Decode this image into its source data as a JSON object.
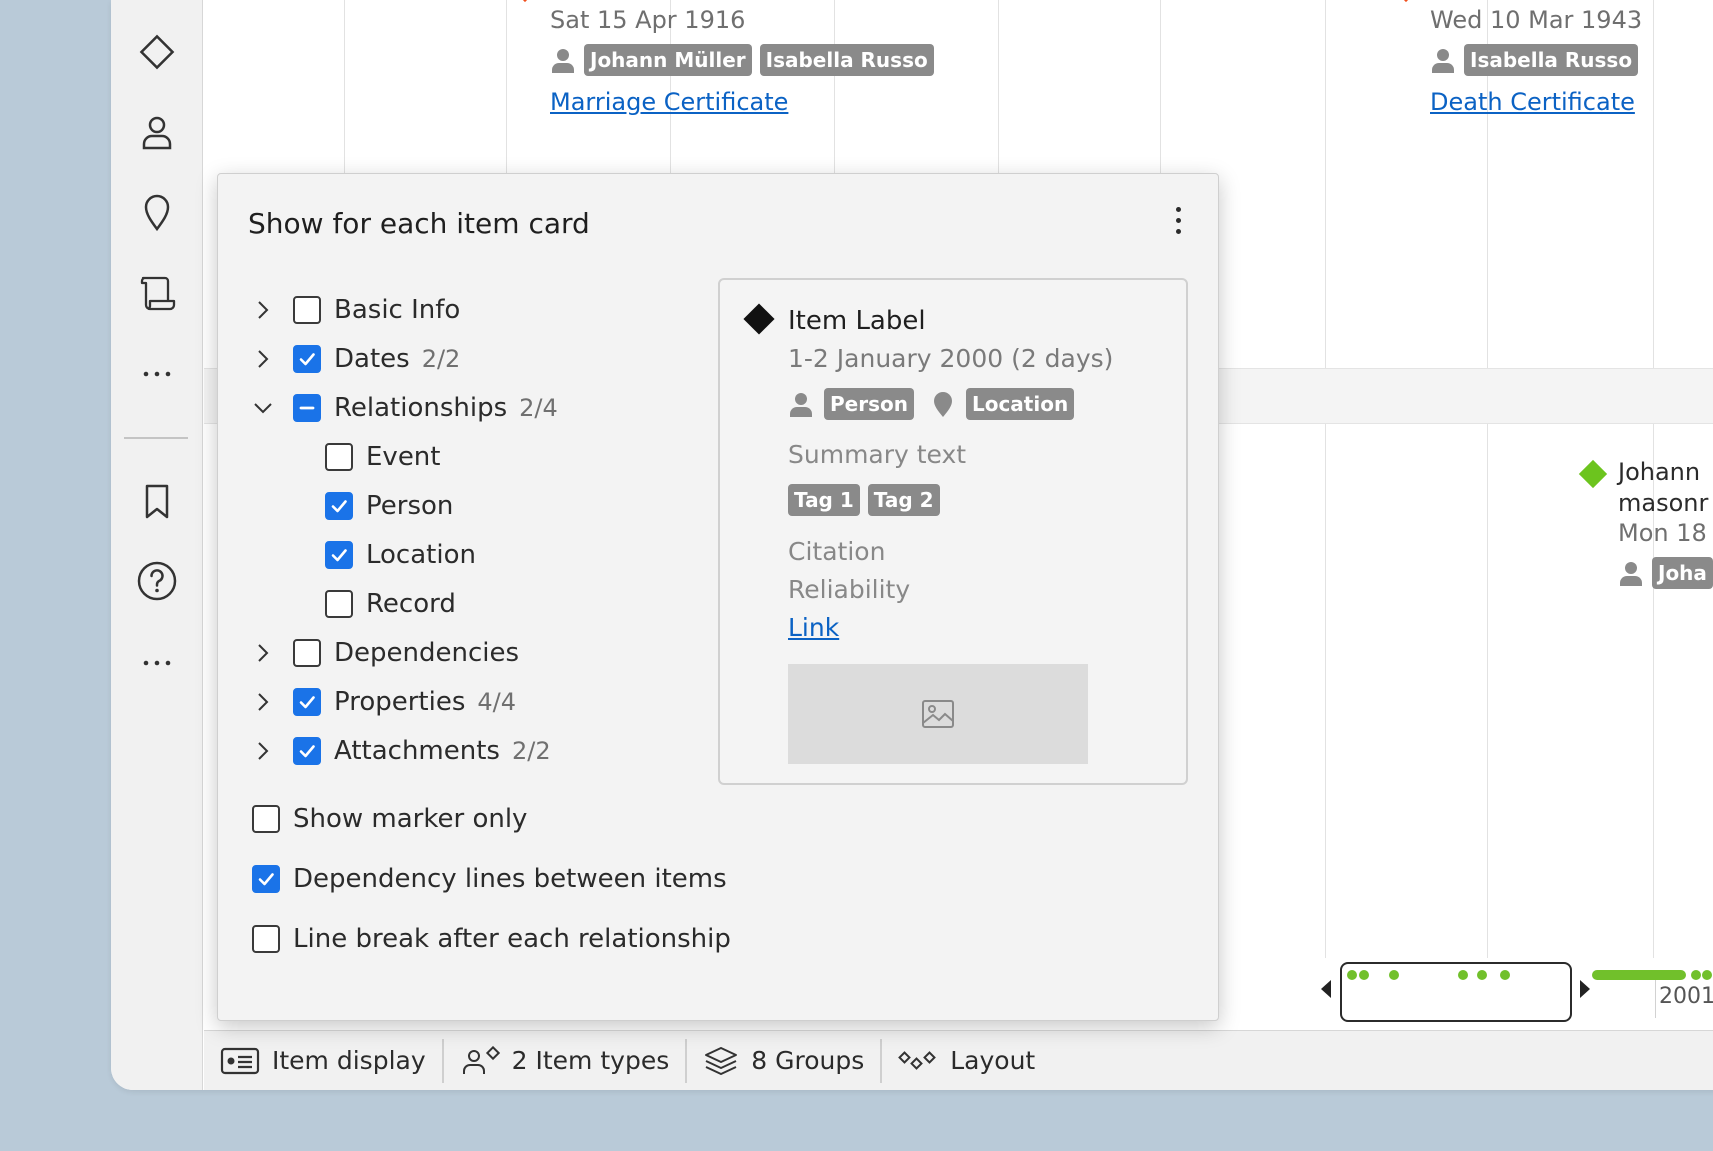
{
  "timeline": {
    "event_left": {
      "date": "Sat 15 Apr 1916",
      "people": [
        "Johann Müller",
        "Isabella Russo"
      ],
      "link": "Marriage Certificate"
    },
    "event_right": {
      "date": "Wed 10 Mar 1943",
      "people": [
        "Isabella Russo"
      ],
      "link": "Death Certificate"
    },
    "event_partial": {
      "title_line1": "Johann",
      "title_line2": "masonr",
      "date": "Mon 18",
      "person": "Joha"
    },
    "marker_colors": {
      "green": "#6cc41e",
      "orange": "#f0501e"
    }
  },
  "popover": {
    "title": "Show for each item card",
    "tree": [
      {
        "label": "Basic Info",
        "count": "",
        "state": "unchecked",
        "expanded": false
      },
      {
        "label": "Dates",
        "count": "2/2",
        "state": "checked",
        "expanded": false
      },
      {
        "label": "Relationships",
        "count": "2/4",
        "state": "indeterminate",
        "expanded": true
      },
      {
        "label": "Event",
        "count": "",
        "state": "unchecked",
        "child": true
      },
      {
        "label": "Person",
        "count": "",
        "state": "checked",
        "child": true
      },
      {
        "label": "Location",
        "count": "",
        "state": "checked",
        "child": true
      },
      {
        "label": "Record",
        "count": "",
        "state": "unchecked",
        "child": true
      },
      {
        "label": "Dependencies",
        "count": "",
        "state": "unchecked",
        "expanded": false
      },
      {
        "label": "Properties",
        "count": "4/4",
        "state": "checked",
        "expanded": false
      },
      {
        "label": "Attachments",
        "count": "2/2",
        "state": "checked",
        "expanded": false
      }
    ],
    "options": [
      {
        "label": "Show marker only",
        "checked": false
      },
      {
        "label": "Dependency lines between items",
        "checked": true
      },
      {
        "label": "Line break after each relationship",
        "checked": false
      }
    ],
    "preview": {
      "label": "Item Label",
      "date": "1-2 January 2000 (2 days)",
      "person_chip": "Person",
      "location_chip": "Location",
      "summary": "Summary text",
      "tags": [
        "Tag 1",
        "Tag 2"
      ],
      "citation": "Citation",
      "reliability": "Reliability",
      "link": "Link"
    }
  },
  "overview": {
    "year": "2001"
  },
  "statusbar": {
    "item_display": "Item display",
    "item_types": "2 Item types",
    "groups": "8 Groups",
    "layout": "Layout"
  },
  "accent": "#1a73e8"
}
